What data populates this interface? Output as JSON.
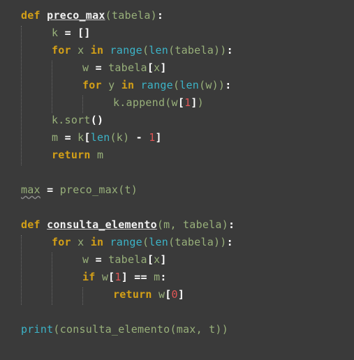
{
  "editor": {
    "lines": [
      {
        "tokens": [
          {
            "t": "def",
            "c": "kw"
          },
          {
            "t": " "
          },
          {
            "t": "preco_max",
            "c": "fn"
          },
          {
            "t": "(tabela)",
            "c": "pr"
          },
          {
            "t": ":",
            "c": "br"
          }
        ]
      },
      {
        "tokens": [
          {
            "t": "k",
            "c": "id"
          },
          {
            "t": " "
          },
          {
            "t": "=",
            "c": "op"
          },
          {
            "t": " "
          },
          {
            "t": "[]",
            "c": "br"
          }
        ]
      },
      {
        "tokens": [
          {
            "t": "for",
            "c": "kw"
          },
          {
            "t": " "
          },
          {
            "t": "x",
            "c": "id"
          },
          {
            "t": " "
          },
          {
            "t": "in",
            "c": "kw"
          },
          {
            "t": " "
          },
          {
            "t": "range",
            "c": "bi"
          },
          {
            "t": "(",
            "c": "pr"
          },
          {
            "t": "len",
            "c": "bi"
          },
          {
            "t": "(tabela))",
            "c": "pr"
          },
          {
            "t": ":",
            "c": "br"
          }
        ]
      },
      {
        "tokens": [
          {
            "t": "w",
            "c": "id"
          },
          {
            "t": " "
          },
          {
            "t": "=",
            "c": "op"
          },
          {
            "t": " "
          },
          {
            "t": "tabela",
            "c": "id"
          },
          {
            "t": "[",
            "c": "br"
          },
          {
            "t": "x",
            "c": "id"
          },
          {
            "t": "]",
            "c": "br"
          }
        ]
      },
      {
        "tokens": [
          {
            "t": "for",
            "c": "kw"
          },
          {
            "t": " "
          },
          {
            "t": "y",
            "c": "id"
          },
          {
            "t": " "
          },
          {
            "t": "in",
            "c": "kw"
          },
          {
            "t": " "
          },
          {
            "t": "range",
            "c": "bi"
          },
          {
            "t": "(",
            "c": "pr"
          },
          {
            "t": "len",
            "c": "bi"
          },
          {
            "t": "(w))",
            "c": "pr"
          },
          {
            "t": ":",
            "c": "br"
          }
        ]
      },
      {
        "tokens": [
          {
            "t": "k.append(w",
            "c": "id"
          },
          {
            "t": "[",
            "c": "br"
          },
          {
            "t": "1",
            "c": "num"
          },
          {
            "t": "]",
            "c": "br"
          },
          {
            "t": ")",
            "c": "pr"
          }
        ]
      },
      {
        "tokens": [
          {
            "t": "k.sort",
            "c": "id"
          },
          {
            "t": "()",
            "c": "br"
          }
        ]
      },
      {
        "tokens": [
          {
            "t": "m",
            "c": "id"
          },
          {
            "t": " "
          },
          {
            "t": "=",
            "c": "op"
          },
          {
            "t": " "
          },
          {
            "t": "k",
            "c": "id"
          },
          {
            "t": "[",
            "c": "br"
          },
          {
            "t": "len",
            "c": "bi"
          },
          {
            "t": "(k)",
            "c": "pr"
          },
          {
            "t": " "
          },
          {
            "t": "-",
            "c": "op"
          },
          {
            "t": " "
          },
          {
            "t": "1",
            "c": "num"
          },
          {
            "t": "]",
            "c": "br"
          }
        ]
      },
      {
        "tokens": [
          {
            "t": "return",
            "c": "kw"
          },
          {
            "t": " "
          },
          {
            "t": "m",
            "c": "id"
          }
        ]
      },
      {
        "tokens": [
          {
            "t": "max",
            "c": "id squiggle"
          },
          {
            "t": " "
          },
          {
            "t": "=",
            "c": "op"
          },
          {
            "t": " "
          },
          {
            "t": "preco_max(t)",
            "c": "id"
          }
        ]
      },
      {
        "tokens": [
          {
            "t": "def",
            "c": "kw"
          },
          {
            "t": " "
          },
          {
            "t": "consulta_elemento",
            "c": "fn"
          },
          {
            "t": "(m, tabela)",
            "c": "pr"
          },
          {
            "t": ":",
            "c": "br"
          }
        ]
      },
      {
        "tokens": [
          {
            "t": "for",
            "c": "kw"
          },
          {
            "t": " "
          },
          {
            "t": "x",
            "c": "id"
          },
          {
            "t": " "
          },
          {
            "t": "in",
            "c": "kw"
          },
          {
            "t": " "
          },
          {
            "t": "range",
            "c": "bi"
          },
          {
            "t": "(",
            "c": "pr"
          },
          {
            "t": "len",
            "c": "bi"
          },
          {
            "t": "(tabela))",
            "c": "pr"
          },
          {
            "t": ":",
            "c": "br"
          }
        ]
      },
      {
        "tokens": [
          {
            "t": "w",
            "c": "id"
          },
          {
            "t": " "
          },
          {
            "t": "=",
            "c": "op"
          },
          {
            "t": " "
          },
          {
            "t": "tabela",
            "c": "id"
          },
          {
            "t": "[",
            "c": "br"
          },
          {
            "t": "x",
            "c": "id"
          },
          {
            "t": "]",
            "c": "br"
          }
        ]
      },
      {
        "tokens": [
          {
            "t": "if",
            "c": "kw"
          },
          {
            "t": " "
          },
          {
            "t": "w",
            "c": "id"
          },
          {
            "t": "[",
            "c": "br"
          },
          {
            "t": "1",
            "c": "num"
          },
          {
            "t": "]",
            "c": "br"
          },
          {
            "t": " "
          },
          {
            "t": "==",
            "c": "op"
          },
          {
            "t": " "
          },
          {
            "t": "m",
            "c": "id"
          },
          {
            "t": ":",
            "c": "br"
          }
        ]
      },
      {
        "tokens": [
          {
            "t": "return",
            "c": "kw"
          },
          {
            "t": " "
          },
          {
            "t": "w",
            "c": "id"
          },
          {
            "t": "[",
            "c": "br"
          },
          {
            "t": "0",
            "c": "num"
          },
          {
            "t": "]",
            "c": "br"
          }
        ]
      },
      {
        "tokens": [
          {
            "t": "print",
            "c": "bi"
          },
          {
            "t": "(",
            "c": "pr"
          },
          {
            "t": "consulta_elemento(max, t)",
            "c": "id"
          },
          {
            "t": ")",
            "c": "pr"
          }
        ]
      }
    ]
  },
  "colors": {
    "background": "#3a3a3a",
    "keyword": "#d4a017",
    "builtin": "#3cb4c8",
    "identifier": "#98b07a",
    "number": "#e05555"
  }
}
